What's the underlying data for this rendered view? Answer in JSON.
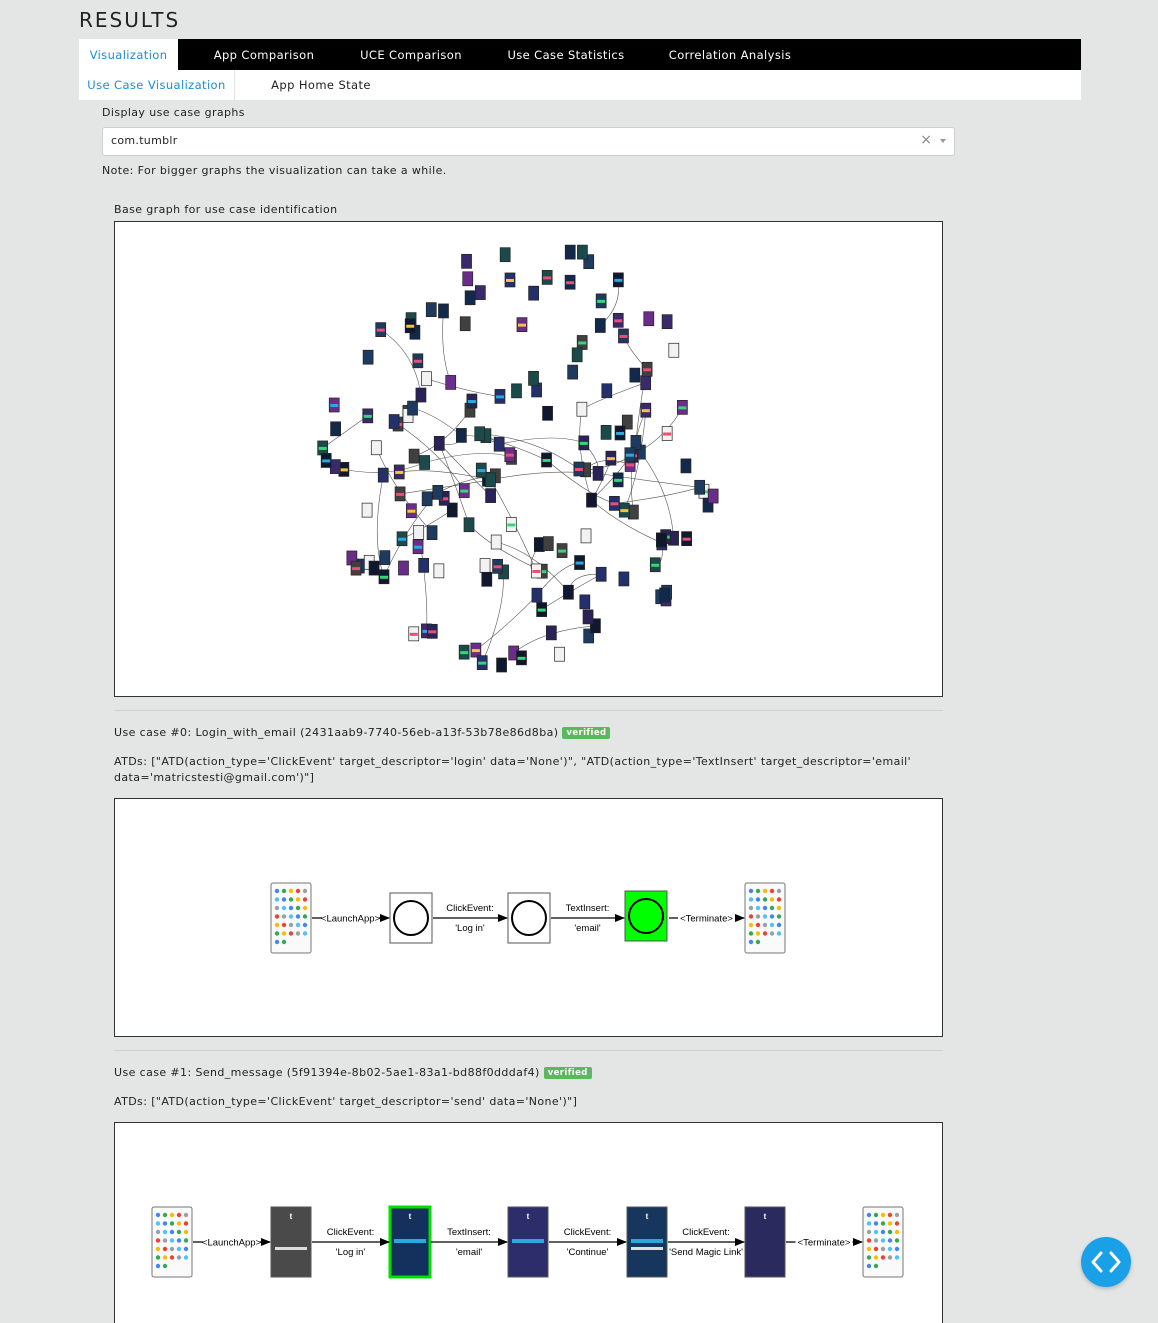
{
  "header": {
    "title": "RESULTS"
  },
  "tabs": [
    "Visualization",
    "App Comparison",
    "UCE Comparison",
    "Use Case Statistics",
    "Correlation Analysis"
  ],
  "subtabs": [
    "Use Case Visualization",
    "App Home State"
  ],
  "graph_select": {
    "label": "Display use case graphs",
    "value": "com.tumblr",
    "clear_symbol": "×"
  },
  "note": "Note: For bigger graphs the visualization can take a while.",
  "base_graph": {
    "title": "Base graph for use case identification"
  },
  "use_cases": [
    {
      "heading": "Use case #0: Login_with_email (2431aab9-7740-56eb-a13f-53b78e86d8ba)",
      "badge": "verified",
      "atds_line1": "ATDs: [\"ATD(action_type='ClickEvent' target_descriptor='login' data='None')\", \"ATD(action_type='TextInsert' target_descriptor='email'",
      "atds_line2": "data='matricstesti@gmail.com')\"]",
      "edges": [
        {
          "a": "<LaunchApp>",
          "b": ""
        },
        {
          "a": "ClickEvent:",
          "b": "'Log in'"
        },
        {
          "a": "TextInsert:",
          "b": "'email'"
        },
        {
          "a": "<Terminate>",
          "b": ""
        }
      ]
    },
    {
      "heading": "Use case #1: Send_message (5f91394e-8b02-5ae1-83a1-bd88f0dddaf4)",
      "badge": "verified",
      "atds_line1": "ATDs: [\"ATD(action_type='ClickEvent' target_descriptor='send' data='None')\"]",
      "edges": [
        {
          "a": "<LaunchApp>",
          "b": ""
        },
        {
          "a": "ClickEvent:",
          "b": "'Log in'"
        },
        {
          "a": "TextInsert:",
          "b": "'email'"
        },
        {
          "a": "ClickEvent:",
          "b": "'Continue'"
        },
        {
          "a": "ClickEvent:",
          "b": "'Send Magic Link'"
        },
        {
          "a": "<Terminate>",
          "b": ""
        }
      ]
    }
  ],
  "colors": {
    "tab_bar": "#000000",
    "accent": "#1b8ed1",
    "verified": "#5cb85c",
    "final_state": "#00ff00",
    "fab": "#1aa0e6"
  },
  "fab_icon": "code-brackets-icon"
}
